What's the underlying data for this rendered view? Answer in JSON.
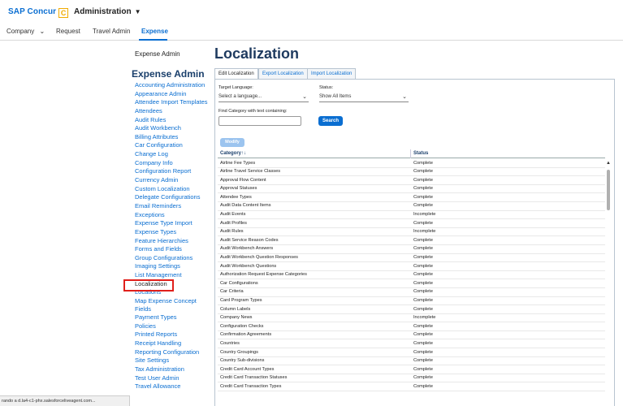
{
  "header": {
    "brand": "SAP Concur",
    "brand_badge": "C",
    "admin_menu": "Administration"
  },
  "nav": {
    "items": [
      {
        "label": "Company",
        "has_caret": true
      },
      {
        "label": "Request"
      },
      {
        "label": "Travel Admin"
      },
      {
        "label": "Expense",
        "active": true
      }
    ]
  },
  "sidebar": {
    "header": "Expense Admin",
    "title": "Expense Admin",
    "links": [
      "Accounting Administration",
      "Appearance Admin",
      "Attendee Import Templates",
      "Attendees",
      "Audit Rules",
      "Audit Workbench",
      "Billing Attributes",
      "Car Configuration",
      "Change Log",
      "Company Info",
      "Configuration Report",
      "Currency Admin",
      "Custom Localization",
      "Delegate Configurations",
      "Email Reminders",
      "Exceptions",
      "Expense Type Import",
      "Expense Types",
      "Feature Hierarchies",
      "Forms and Fields",
      "Group Configurations",
      "Imaging Settings",
      "List Management",
      "Localization",
      "Locations",
      "Map Expense Concept Fields",
      "Payment Types",
      "Policies",
      "Printed Reports",
      "Receipt Handling",
      "Reporting Configuration",
      "Site Settings",
      "Tax Administration",
      "Test User Admin",
      "Travel Allowance"
    ],
    "current": "Localization"
  },
  "main": {
    "title": "Localization",
    "tabs": [
      "Edit Localization",
      "Export Localization",
      "Import Localization"
    ],
    "active_tab": "Edit Localization",
    "target_language_label": "Target Language:",
    "target_language_value": "Select a language...",
    "status_label": "Status:",
    "status_value": "Show All Items",
    "find_label": "Find Category with text containing:",
    "find_value": "",
    "search_button": "Search",
    "modify_button": "Modify",
    "columns": [
      "Category",
      "Status"
    ],
    "sort_indicator": "↑↓",
    "rows": [
      [
        "Airline Fee Types",
        "Complete"
      ],
      [
        "Airline Travel Service Classes",
        "Complete"
      ],
      [
        "Approval Flow Content",
        "Complete"
      ],
      [
        "Approval Statuses",
        "Complete"
      ],
      [
        "Attendee Types",
        "Complete"
      ],
      [
        "Audit Data Content Items",
        "Complete"
      ],
      [
        "Audit Events",
        "Incomplete"
      ],
      [
        "Audit Profiles",
        "Complete"
      ],
      [
        "Audit Rules",
        "Incomplete"
      ],
      [
        "Audit Service Reason Codes",
        "Complete"
      ],
      [
        "Audit Workbench Answers",
        "Complete"
      ],
      [
        "Audit Workbench Question Responses",
        "Complete"
      ],
      [
        "Audit Workbench Questions",
        "Complete"
      ],
      [
        "Authorization Request Expense Categories",
        "Complete"
      ],
      [
        "Car Configurations",
        "Complete"
      ],
      [
        "Car Criteria",
        "Complete"
      ],
      [
        "Card Program Types",
        "Complete"
      ],
      [
        "Column Labels",
        "Complete"
      ],
      [
        "Company News",
        "Incomplete"
      ],
      [
        "Configuration Checks",
        "Complete"
      ],
      [
        "Confirmation Agreements",
        "Complete"
      ],
      [
        "Countries",
        "Complete"
      ],
      [
        "Country Groupings",
        "Complete"
      ],
      [
        "Country Sub-divisions",
        "Complete"
      ],
      [
        "Credit Card Account Types",
        "Complete"
      ],
      [
        "Credit Card Transaction Statuses",
        "Complete"
      ],
      [
        "Credit Card Transaction Types",
        "Complete"
      ]
    ]
  },
  "statusbar": {
    "text": "rando a d.la4-c1-phx.salesforceliveagent.com..."
  }
}
